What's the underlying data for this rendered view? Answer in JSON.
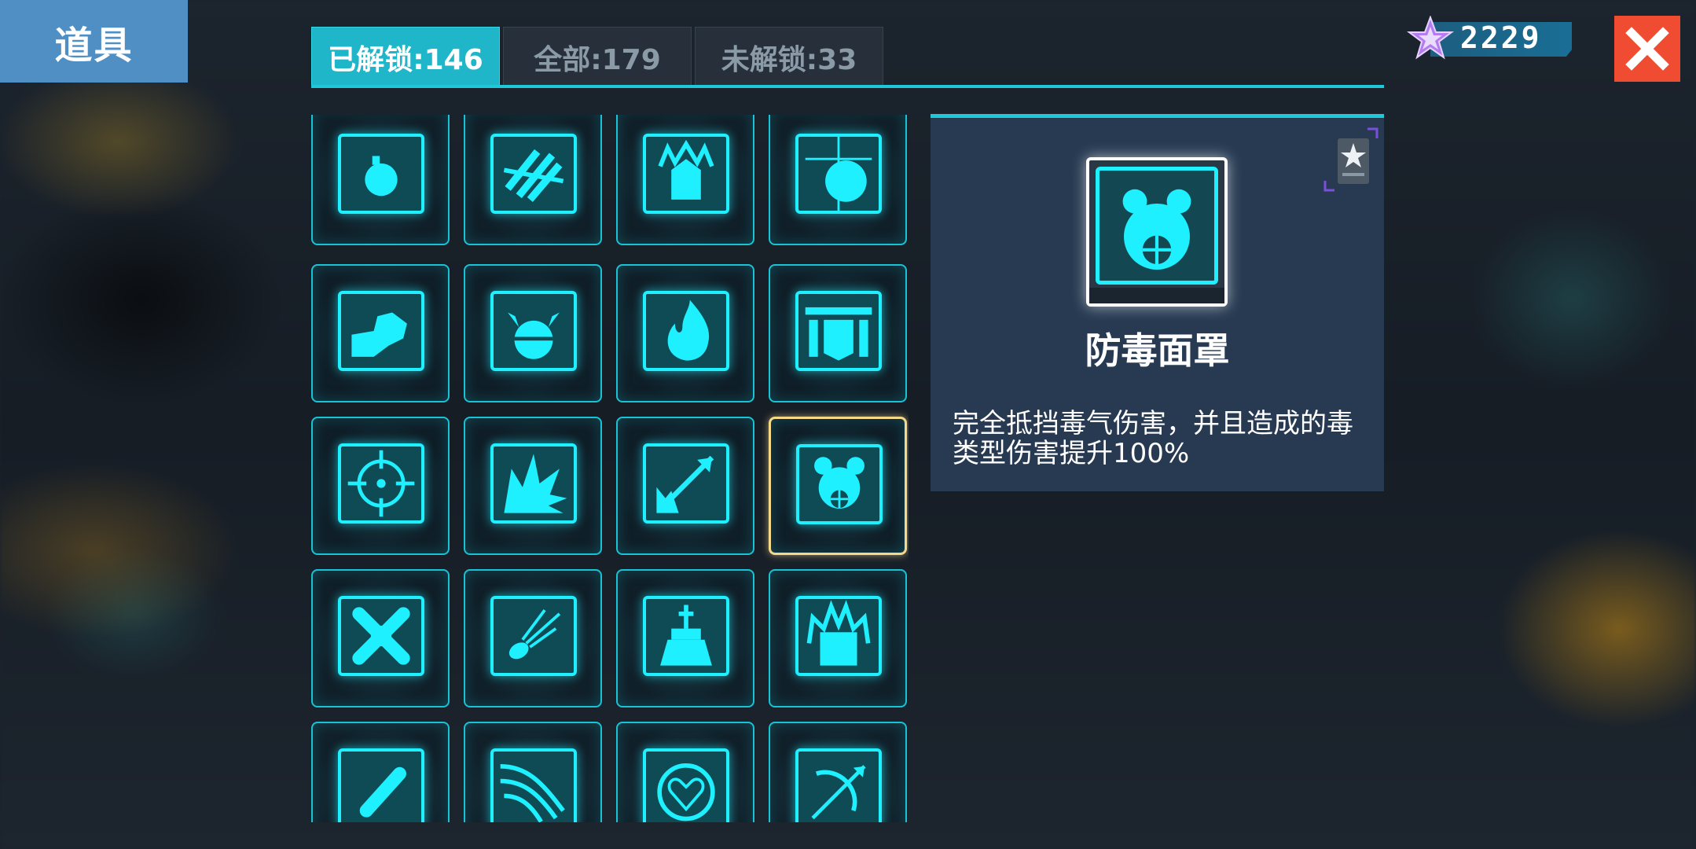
{
  "header": {
    "title": "道具"
  },
  "tabs": [
    {
      "label": "已解锁:146",
      "active": true
    },
    {
      "label": "全部:179",
      "active": false
    },
    {
      "label": "未解锁:33",
      "active": false
    }
  ],
  "currency": {
    "amount": "2229",
    "icon": "purple-star-gem-icon"
  },
  "close": {
    "icon": "close-x-icon"
  },
  "items": [
    {
      "icon": "bomb-icon"
    },
    {
      "icon": "armor-plates-icon"
    },
    {
      "icon": "fire-armor-icon"
    },
    {
      "icon": "energy-ball-icon"
    },
    {
      "icon": "muscle-arm-icon"
    },
    {
      "icon": "horned-helmet-icon"
    },
    {
      "icon": "flame-icon"
    },
    {
      "icon": "banner-icon"
    },
    {
      "icon": "crosshair-target-icon"
    },
    {
      "icon": "explosion-icon"
    },
    {
      "icon": "diagonal-arrow-icon"
    },
    {
      "icon": "gas-mask-icon",
      "selected": true
    },
    {
      "icon": "bone-cross-icon"
    },
    {
      "icon": "comet-icon"
    },
    {
      "icon": "tombstone-icon"
    },
    {
      "icon": "burning-shield-icon"
    },
    {
      "icon": "pill-icon"
    },
    {
      "icon": "wind-shot-icon"
    },
    {
      "icon": "heart-circle-icon"
    },
    {
      "icon": "bow-arrow-icon"
    }
  ],
  "detail": {
    "name": "防毒面罩",
    "description": "完全抵挡毒气伤害，并且造成的毒类型伤害提升100%",
    "icon": "gas-mask-icon",
    "badge_icon": "star-card-badge-icon"
  },
  "colors": {
    "accent": "#1fc8d8",
    "icon_glow": "#1ef0ff",
    "selected_border": "#f4d98a",
    "title_bg": "#4f8fc4",
    "close_bg": "#f04c31",
    "detail_bg": "#273a52"
  }
}
